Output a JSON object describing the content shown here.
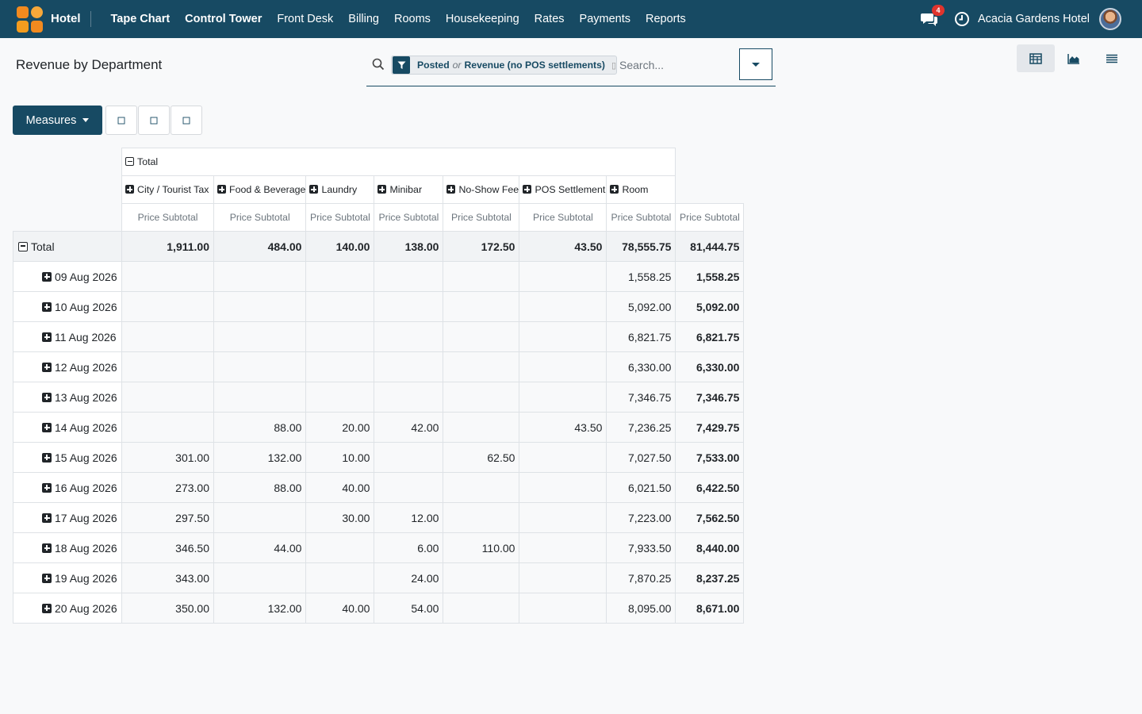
{
  "app": {
    "brand": "Hotel",
    "nav": [
      "Tape Chart",
      "Control Tower",
      "Front Desk",
      "Billing",
      "Rooms",
      "Housekeeping",
      "Rates",
      "Payments",
      "Reports"
    ],
    "chat_count": "4",
    "company": "Acacia Gardens Hotel"
  },
  "page": {
    "title": "Revenue by Department"
  },
  "search": {
    "facet_part1": "Posted",
    "facet_or": "or",
    "facet_part2": "Revenue (no POS settlements)",
    "placeholder": "Search..."
  },
  "toolbar": {
    "measures_label": "Measures"
  },
  "pivot": {
    "col_total_label": "Total",
    "columns": [
      "City / Tourist Tax",
      "Food & Beverage",
      "Laundry",
      "Minibar",
      "No-Show Fee",
      "POS Settlement",
      "Room"
    ],
    "measure_label": "Price Subtotal",
    "row_total_label": "Total",
    "totals": [
      "1,911.00",
      "484.00",
      "140.00",
      "138.00",
      "172.50",
      "43.50",
      "78,555.75",
      "81,444.75"
    ],
    "rows": [
      {
        "label": "09 Aug 2026",
        "values": [
          "",
          "",
          "",
          "",
          "",
          "",
          "1,558.25",
          "1,558.25"
        ]
      },
      {
        "label": "10 Aug 2026",
        "values": [
          "",
          "",
          "",
          "",
          "",
          "",
          "5,092.00",
          "5,092.00"
        ]
      },
      {
        "label": "11 Aug 2026",
        "values": [
          "",
          "",
          "",
          "",
          "",
          "",
          "6,821.75",
          "6,821.75"
        ]
      },
      {
        "label": "12 Aug 2026",
        "values": [
          "",
          "",
          "",
          "",
          "",
          "",
          "6,330.00",
          "6,330.00"
        ]
      },
      {
        "label": "13 Aug 2026",
        "values": [
          "",
          "",
          "",
          "",
          "",
          "",
          "7,346.75",
          "7,346.75"
        ]
      },
      {
        "label": "14 Aug 2026",
        "values": [
          "",
          "88.00",
          "20.00",
          "42.00",
          "",
          "43.50",
          "7,236.25",
          "7,429.75"
        ]
      },
      {
        "label": "15 Aug 2026",
        "values": [
          "301.00",
          "132.00",
          "10.00",
          "",
          "62.50",
          "",
          "7,027.50",
          "7,533.00"
        ]
      },
      {
        "label": "16 Aug 2026",
        "values": [
          "273.00",
          "88.00",
          "40.00",
          "",
          "",
          "",
          "6,021.50",
          "6,422.50"
        ]
      },
      {
        "label": "17 Aug 2026",
        "values": [
          "297.50",
          "",
          "30.00",
          "12.00",
          "",
          "",
          "7,223.00",
          "7,562.50"
        ]
      },
      {
        "label": "18 Aug 2026",
        "values": [
          "346.50",
          "44.00",
          "",
          "6.00",
          "110.00",
          "",
          "7,933.50",
          "8,440.00"
        ]
      },
      {
        "label": "19 Aug 2026",
        "values": [
          "343.00",
          "",
          "",
          "24.00",
          "",
          "",
          "7,870.25",
          "8,237.25"
        ]
      },
      {
        "label": "20 Aug 2026",
        "values": [
          "350.00",
          "132.00",
          "40.00",
          "54.00",
          "",
          "",
          "8,095.00",
          "8,671.00"
        ]
      }
    ]
  }
}
